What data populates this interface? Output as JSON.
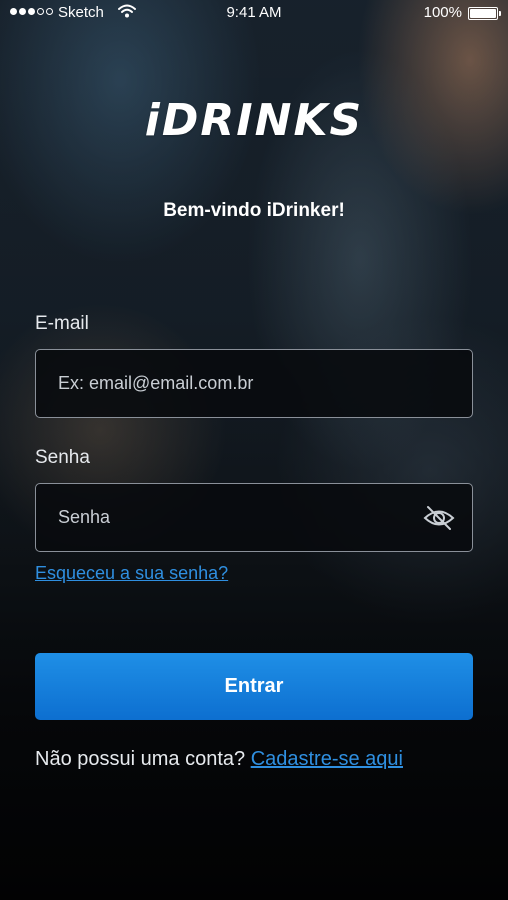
{
  "status_bar": {
    "carrier": "Sketch",
    "time": "9:41 AM",
    "battery": "100%",
    "wifi_icon": "wifi-icon",
    "battery_icon": "battery-icon",
    "battery_level": 1.0
  },
  "app": {
    "logo": "iDRINKS",
    "welcome": "Bem-vindo iDrinker!"
  },
  "form": {
    "email_label": "E-mail",
    "email_placeholder": "Ex: email@email.com.br",
    "email_value": "",
    "password_label": "Senha",
    "password_placeholder": "Senha",
    "password_value": "",
    "password_toggle_icon": "eye-off-icon",
    "forgot_link": "Esqueceu a sua senha?",
    "submit_label": "Entrar"
  },
  "signup": {
    "prompt": "Não possui uma conta?",
    "link": "Cadastre-se aqui"
  },
  "colors": {
    "accent": "#1a82dd",
    "link": "#2f8fe0"
  }
}
